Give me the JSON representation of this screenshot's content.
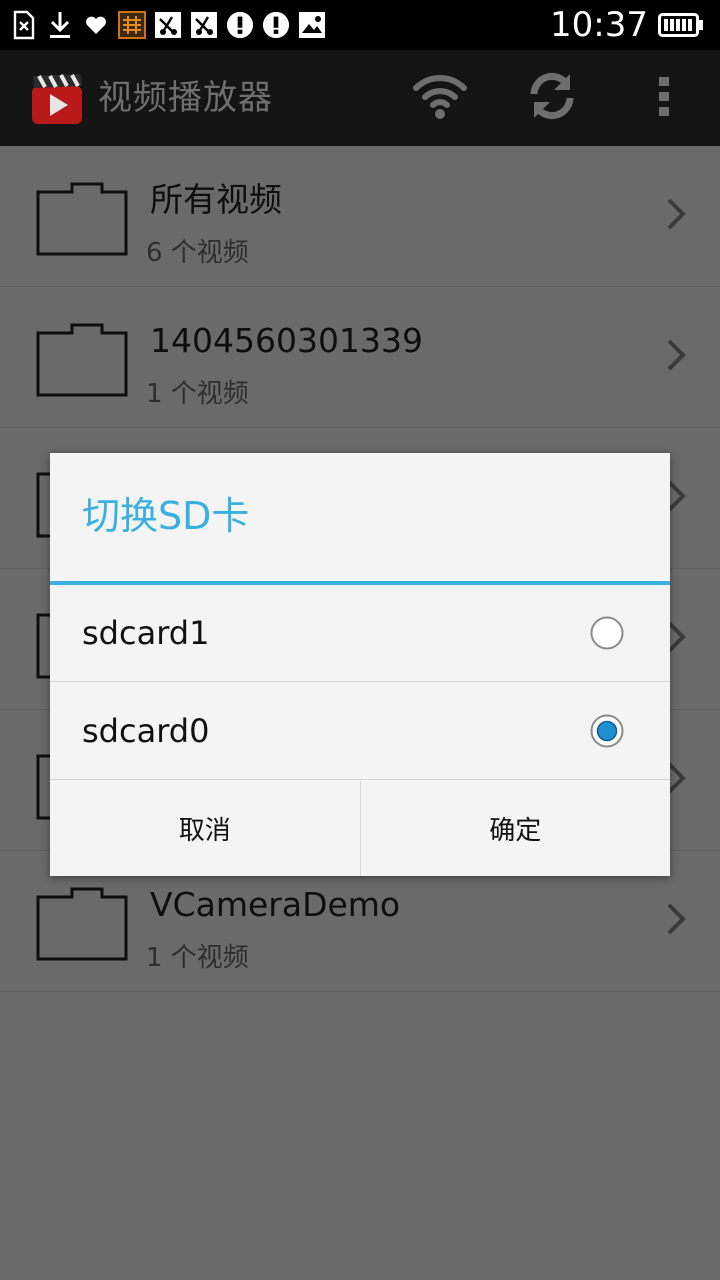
{
  "status_bar": {
    "time": "10:37",
    "icons": [
      "sim-icon",
      "download-icon",
      "heart-icon",
      "app-notify-icon",
      "mute-icon",
      "mute-icon",
      "alert-icon",
      "alert-icon",
      "image-icon"
    ],
    "battery": "battery-icon"
  },
  "action_bar": {
    "title": "视频播放器",
    "icons": {
      "wifi": "wifi-icon",
      "refresh": "refresh-icon",
      "more": "overflow-menu-icon"
    }
  },
  "folders": [
    {
      "name": "所有视频",
      "count": "6 个视频"
    },
    {
      "name": "1404560301339",
      "count": "1 个视频"
    },
    {
      "name": "",
      "count": ""
    },
    {
      "name": "",
      "count": ""
    },
    {
      "name": "",
      "count": ""
    },
    {
      "name": "VCameraDemo",
      "count": "1 个视频"
    }
  ],
  "dialog": {
    "title": "切换SD卡",
    "options": [
      {
        "label": "sdcard1",
        "selected": false
      },
      {
        "label": "sdcard0",
        "selected": true
      }
    ],
    "cancel_label": "取消",
    "ok_label": "确定"
  },
  "colors": {
    "accent": "#39b0e0",
    "radio_selected": "#1e8fd1"
  }
}
